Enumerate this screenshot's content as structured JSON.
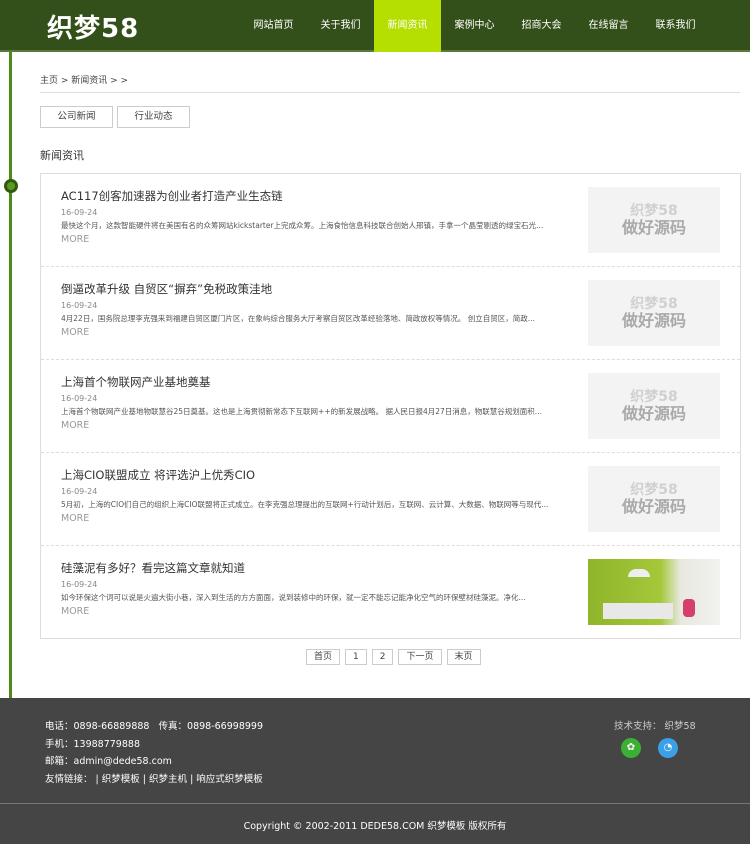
{
  "header": {
    "logo": "织梦58",
    "nav": [
      "网站首页",
      "关于我们",
      "新闻资讯",
      "案例中心",
      "招商大会",
      "在线留言",
      "联系我们"
    ],
    "active_index": 2
  },
  "breadcrumb": "主页 > 新闻资讯 > >",
  "tabs": [
    "公司新闻",
    "行业动态"
  ],
  "section_title": "新闻资讯",
  "thumb_placeholder": {
    "line1": "织梦58",
    "line2": "做好源码"
  },
  "articles": [
    {
      "title": "AC117创客加速器为创业者打造产业生态链",
      "date": "16-09-24",
      "summary": "最快这个月，这款智能硬件将在美国有名的众筹网站kickstarter上完成众筹。上海食怡信息科技联合创始人邢镇，手拿一个晶莹剔透的绿宝石光...",
      "more": "MORE"
    },
    {
      "title": "倒逼改革升级 自贸区“摒弃”免税政策洼地",
      "date": "16-09-24",
      "summary": "4月22日，国务院总理李克强来到福建自贸区厦门片区，在象屿综合服务大厅考察自贸区改革经验落地、简政放权等情况。 创立自贸区，简政...",
      "more": "MORE"
    },
    {
      "title": "上海首个物联网产业基地奠基",
      "date": "16-09-24",
      "summary": "上海首个物联网产业基地物联慧谷25日奠基。这也是上海贯彻新常态下互联网++的新发展战略。 据人民日报4月27日消息，物联慧谷规划面积...",
      "more": "MORE"
    },
    {
      "title": "上海CIO联盟成立 将评选沪上优秀CIO",
      "date": "16-09-24",
      "summary": "5月初，上海的CIO们自己的组织上海CIO联盟将正式成立。在李克强总理提出的互联网+行动计划后，互联网、云计算、大数据、物联网等与现代...",
      "more": "MORE"
    },
    {
      "title": "硅藻泥有多好？看完这篇文章就知道",
      "date": "16-09-24",
      "summary": "如今环保这个词可以说是火遍大街小巷，深入到生活的方方面面，说到装修中的环保，就一定不能忘记能净化空气的环保壁材硅藻泥。净化...",
      "more": "MORE"
    }
  ],
  "pager": [
    "首页",
    "1",
    "2",
    "下一页",
    "末页"
  ],
  "footer": {
    "phone": "电话：0898-66889888",
    "fax": "传真：0898-66998999",
    "mobile": "手机：13988779888",
    "email": "邮箱：admin@dede58.com",
    "links_label": "友情链接：",
    "links": [
      "织梦模板",
      "织梦主机",
      "响应式织梦模板"
    ],
    "support": "技术支持： 织梦58",
    "copyright": "Copyright © 2002-2011 DEDE58.COM 织梦模板 版权所有"
  },
  "colors": {
    "header": "#34501a",
    "accent": "#b4df00",
    "footer": "#454545"
  }
}
